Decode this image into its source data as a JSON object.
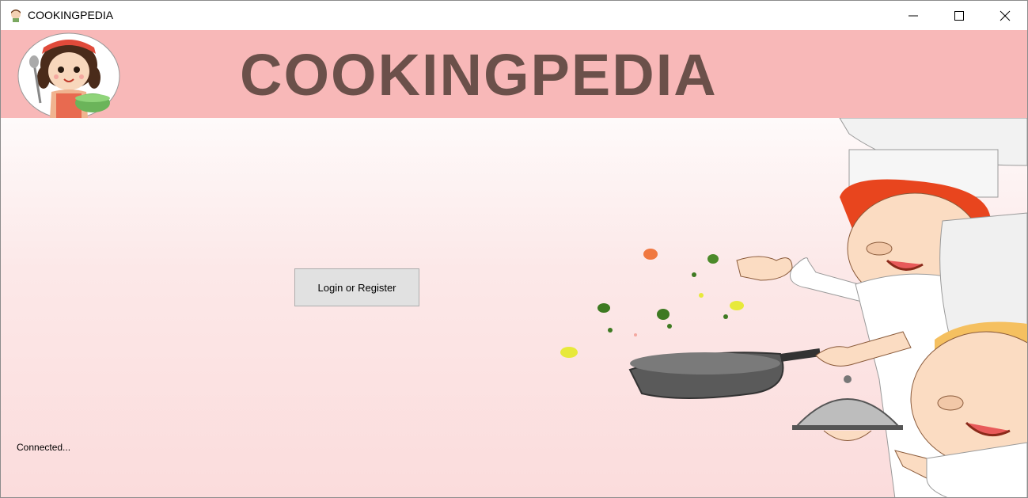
{
  "window": {
    "title": "COOKINGPEDIA",
    "controls": {
      "minimize": "minimize-icon",
      "maximize": "maximize-icon",
      "close": "close-icon"
    }
  },
  "banner": {
    "title": "COOKINGPEDIA",
    "background": "#f8b8b8",
    "text_color": "#6b504a"
  },
  "main": {
    "login_button_label": "Login or Register",
    "status_text": "Connected..."
  }
}
